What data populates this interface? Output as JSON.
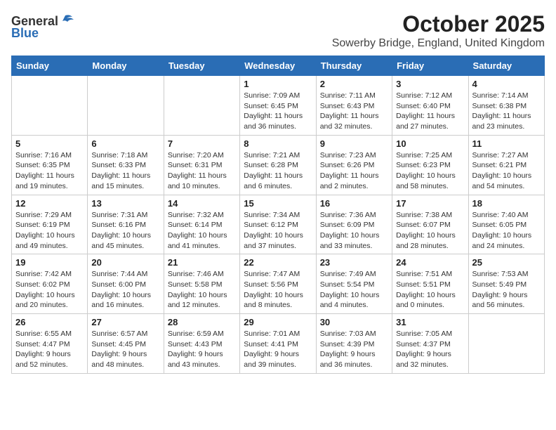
{
  "header": {
    "logo_general": "General",
    "logo_blue": "Blue",
    "title": "October 2025",
    "subtitle": "Sowerby Bridge, England, United Kingdom"
  },
  "calendar": {
    "headers": [
      "Sunday",
      "Monday",
      "Tuesday",
      "Wednesday",
      "Thursday",
      "Friday",
      "Saturday"
    ],
    "weeks": [
      [
        {
          "day": "",
          "detail": ""
        },
        {
          "day": "",
          "detail": ""
        },
        {
          "day": "",
          "detail": ""
        },
        {
          "day": "1",
          "detail": "Sunrise: 7:09 AM\nSunset: 6:45 PM\nDaylight: 11 hours\nand 36 minutes."
        },
        {
          "day": "2",
          "detail": "Sunrise: 7:11 AM\nSunset: 6:43 PM\nDaylight: 11 hours\nand 32 minutes."
        },
        {
          "day": "3",
          "detail": "Sunrise: 7:12 AM\nSunset: 6:40 PM\nDaylight: 11 hours\nand 27 minutes."
        },
        {
          "day": "4",
          "detail": "Sunrise: 7:14 AM\nSunset: 6:38 PM\nDaylight: 11 hours\nand 23 minutes."
        }
      ],
      [
        {
          "day": "5",
          "detail": "Sunrise: 7:16 AM\nSunset: 6:35 PM\nDaylight: 11 hours\nand 19 minutes."
        },
        {
          "day": "6",
          "detail": "Sunrise: 7:18 AM\nSunset: 6:33 PM\nDaylight: 11 hours\nand 15 minutes."
        },
        {
          "day": "7",
          "detail": "Sunrise: 7:20 AM\nSunset: 6:31 PM\nDaylight: 11 hours\nand 10 minutes."
        },
        {
          "day": "8",
          "detail": "Sunrise: 7:21 AM\nSunset: 6:28 PM\nDaylight: 11 hours\nand 6 minutes."
        },
        {
          "day": "9",
          "detail": "Sunrise: 7:23 AM\nSunset: 6:26 PM\nDaylight: 11 hours\nand 2 minutes."
        },
        {
          "day": "10",
          "detail": "Sunrise: 7:25 AM\nSunset: 6:23 PM\nDaylight: 10 hours\nand 58 minutes."
        },
        {
          "day": "11",
          "detail": "Sunrise: 7:27 AM\nSunset: 6:21 PM\nDaylight: 10 hours\nand 54 minutes."
        }
      ],
      [
        {
          "day": "12",
          "detail": "Sunrise: 7:29 AM\nSunset: 6:19 PM\nDaylight: 10 hours\nand 49 minutes."
        },
        {
          "day": "13",
          "detail": "Sunrise: 7:31 AM\nSunset: 6:16 PM\nDaylight: 10 hours\nand 45 minutes."
        },
        {
          "day": "14",
          "detail": "Sunrise: 7:32 AM\nSunset: 6:14 PM\nDaylight: 10 hours\nand 41 minutes."
        },
        {
          "day": "15",
          "detail": "Sunrise: 7:34 AM\nSunset: 6:12 PM\nDaylight: 10 hours\nand 37 minutes."
        },
        {
          "day": "16",
          "detail": "Sunrise: 7:36 AM\nSunset: 6:09 PM\nDaylight: 10 hours\nand 33 minutes."
        },
        {
          "day": "17",
          "detail": "Sunrise: 7:38 AM\nSunset: 6:07 PM\nDaylight: 10 hours\nand 28 minutes."
        },
        {
          "day": "18",
          "detail": "Sunrise: 7:40 AM\nSunset: 6:05 PM\nDaylight: 10 hours\nand 24 minutes."
        }
      ],
      [
        {
          "day": "19",
          "detail": "Sunrise: 7:42 AM\nSunset: 6:02 PM\nDaylight: 10 hours\nand 20 minutes."
        },
        {
          "day": "20",
          "detail": "Sunrise: 7:44 AM\nSunset: 6:00 PM\nDaylight: 10 hours\nand 16 minutes."
        },
        {
          "day": "21",
          "detail": "Sunrise: 7:46 AM\nSunset: 5:58 PM\nDaylight: 10 hours\nand 12 minutes."
        },
        {
          "day": "22",
          "detail": "Sunrise: 7:47 AM\nSunset: 5:56 PM\nDaylight: 10 hours\nand 8 minutes."
        },
        {
          "day": "23",
          "detail": "Sunrise: 7:49 AM\nSunset: 5:54 PM\nDaylight: 10 hours\nand 4 minutes."
        },
        {
          "day": "24",
          "detail": "Sunrise: 7:51 AM\nSunset: 5:51 PM\nDaylight: 10 hours\nand 0 minutes."
        },
        {
          "day": "25",
          "detail": "Sunrise: 7:53 AM\nSunset: 5:49 PM\nDaylight: 9 hours\nand 56 minutes."
        }
      ],
      [
        {
          "day": "26",
          "detail": "Sunrise: 6:55 AM\nSunset: 4:47 PM\nDaylight: 9 hours\nand 52 minutes."
        },
        {
          "day": "27",
          "detail": "Sunrise: 6:57 AM\nSunset: 4:45 PM\nDaylight: 9 hours\nand 48 minutes."
        },
        {
          "day": "28",
          "detail": "Sunrise: 6:59 AM\nSunset: 4:43 PM\nDaylight: 9 hours\nand 43 minutes."
        },
        {
          "day": "29",
          "detail": "Sunrise: 7:01 AM\nSunset: 4:41 PM\nDaylight: 9 hours\nand 39 minutes."
        },
        {
          "day": "30",
          "detail": "Sunrise: 7:03 AM\nSunset: 4:39 PM\nDaylight: 9 hours\nand 36 minutes."
        },
        {
          "day": "31",
          "detail": "Sunrise: 7:05 AM\nSunset: 4:37 PM\nDaylight: 9 hours\nand 32 minutes."
        },
        {
          "day": "",
          "detail": ""
        }
      ]
    ]
  }
}
